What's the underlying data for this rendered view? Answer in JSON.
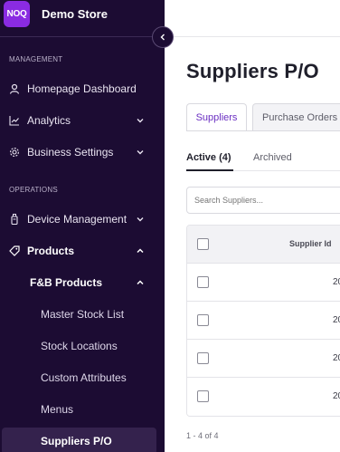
{
  "brand": {
    "logo_text": "NOQ",
    "store_name": "Demo Store",
    "accent": "#8a2be2"
  },
  "sidebar": {
    "sections": {
      "management": "MANAGEMENT",
      "operations": "OPERATIONS"
    },
    "items": {
      "homepage_dashboard": "Homepage Dashboard",
      "analytics": "Analytics",
      "business_settings": "Business Settings",
      "device_management": "Device Management",
      "products": "Products",
      "fb_products": "F&B Products",
      "master_stock_list": "Master Stock List",
      "stock_locations": "Stock Locations",
      "custom_attributes": "Custom Attributes",
      "menus": "Menus",
      "suppliers_po": "Suppliers P/O"
    },
    "background": "#1c0c33",
    "active_background": "#34224d"
  },
  "main": {
    "title": "Suppliers P/O",
    "tabs": {
      "suppliers": "Suppliers",
      "purchase_orders": "Purchase Orders"
    },
    "subtabs": {
      "active": "Active (4)",
      "archived": "Archived"
    },
    "search_placeholder": "Search Suppliers...",
    "table": {
      "header": "Supplier Id",
      "rows": [
        "20",
        "20",
        "20",
        "20"
      ]
    },
    "pagination": "1 - 4 of 4",
    "accent": "#6b2fc2"
  }
}
